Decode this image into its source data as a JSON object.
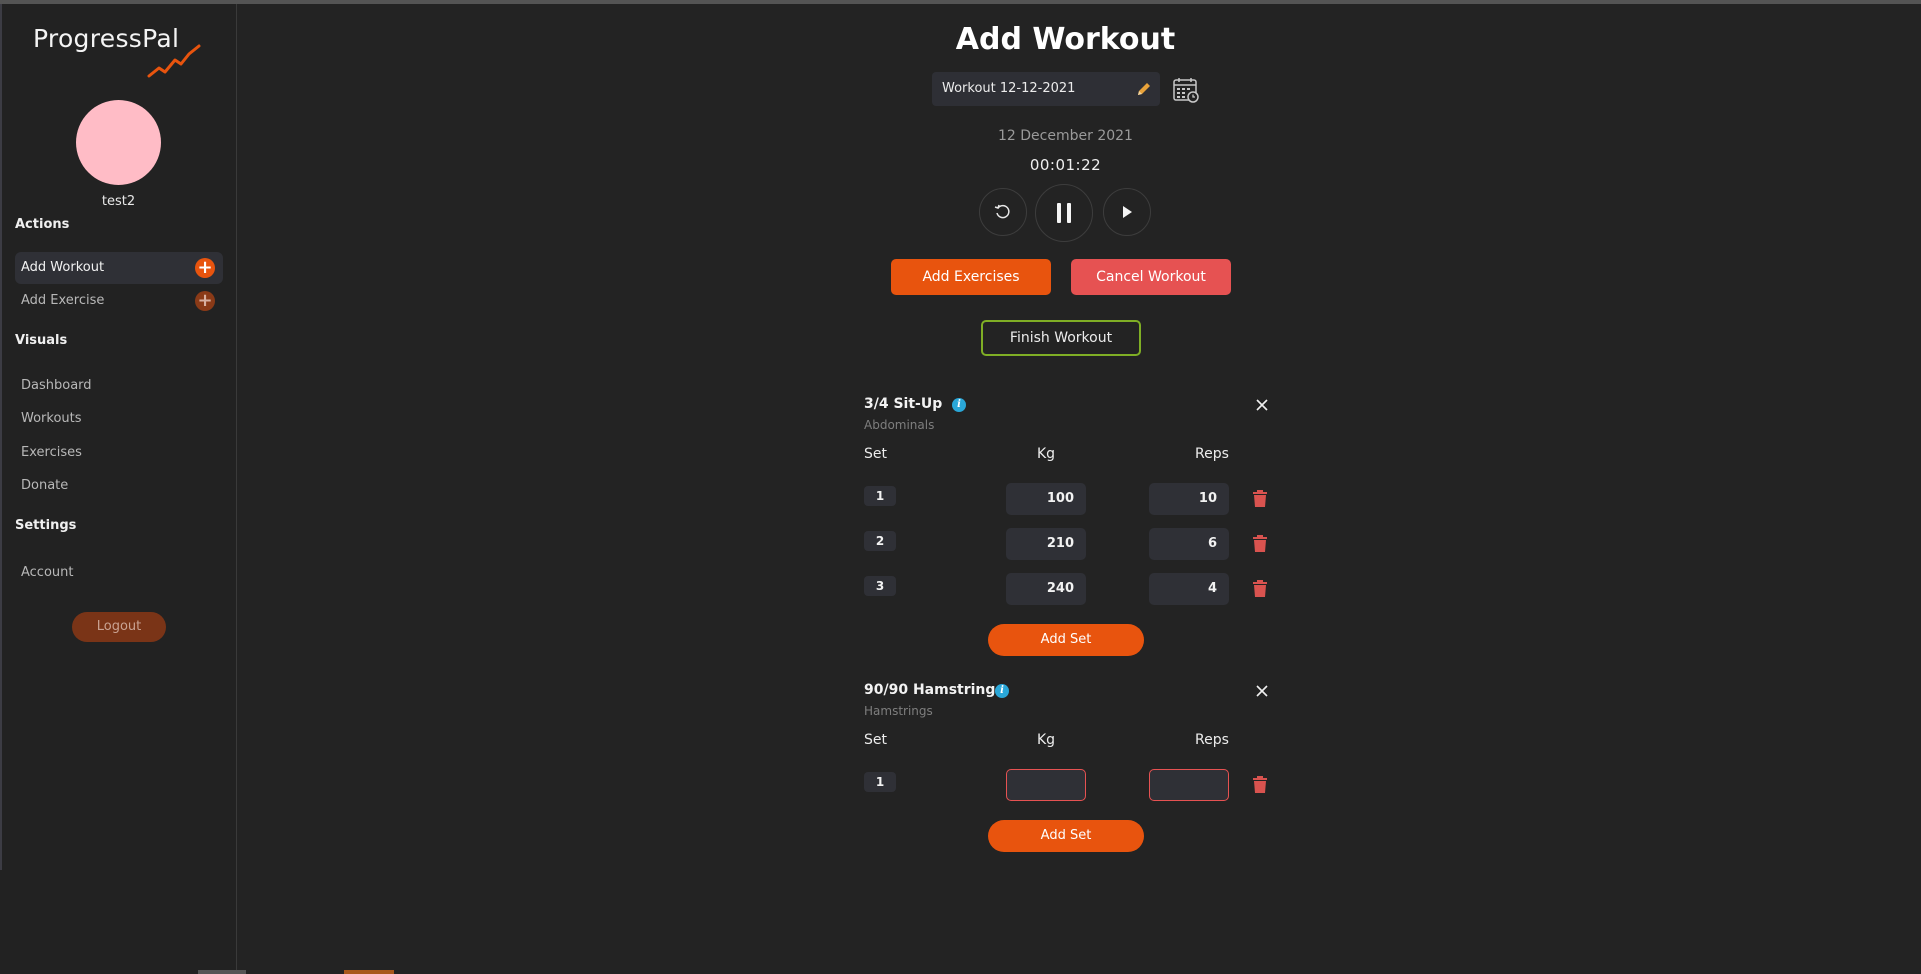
{
  "app": {
    "name": "ProgressPal",
    "username": "test2"
  },
  "sidebar": {
    "sections": {
      "actions": "Actions",
      "visuals": "Visuals",
      "settings": "Settings"
    },
    "actions": [
      {
        "label": "Add Workout",
        "icon": "plus-circle-icon",
        "active": true
      },
      {
        "label": "Add Exercise",
        "icon": "plus-circle-icon",
        "active": false
      }
    ],
    "visuals": [
      {
        "label": "Dashboard"
      },
      {
        "label": "Workouts"
      },
      {
        "label": "Exercises"
      },
      {
        "label": "Donate"
      }
    ],
    "settings": [
      {
        "label": "Account"
      }
    ],
    "logout_label": "Logout"
  },
  "main": {
    "title": "Add Workout",
    "workout_name": "Workout 12-12-2021",
    "date": "12 December 2021",
    "timer": "00:01:22",
    "buttons": {
      "add_exercises": "Add Exercises",
      "cancel_workout": "Cancel Workout",
      "finish_workout": "Finish Workout"
    },
    "columns": {
      "set": "Set",
      "kg": "Kg",
      "reps": "Reps"
    },
    "exercises": [
      {
        "name": "3/4 Sit-Up",
        "muscle": "Abdominals",
        "sets": [
          {
            "set": "1",
            "kg": "100",
            "reps": "10"
          },
          {
            "set": "2",
            "kg": "210",
            "reps": "6"
          },
          {
            "set": "3",
            "kg": "240",
            "reps": "4"
          }
        ],
        "add_set_label": "Add Set"
      },
      {
        "name": "90/90 Hamstring",
        "muscle": "Hamstrings",
        "sets": [
          {
            "set": "1",
            "kg": "",
            "reps": ""
          }
        ],
        "add_set_label": "Add Set"
      }
    ]
  },
  "colors": {
    "accent": "#e8540e",
    "danger": "#e65252",
    "success_border": "#7fae25",
    "info": "#2aa7d8",
    "avatar": "#ffbcc6",
    "background": "#232323"
  }
}
